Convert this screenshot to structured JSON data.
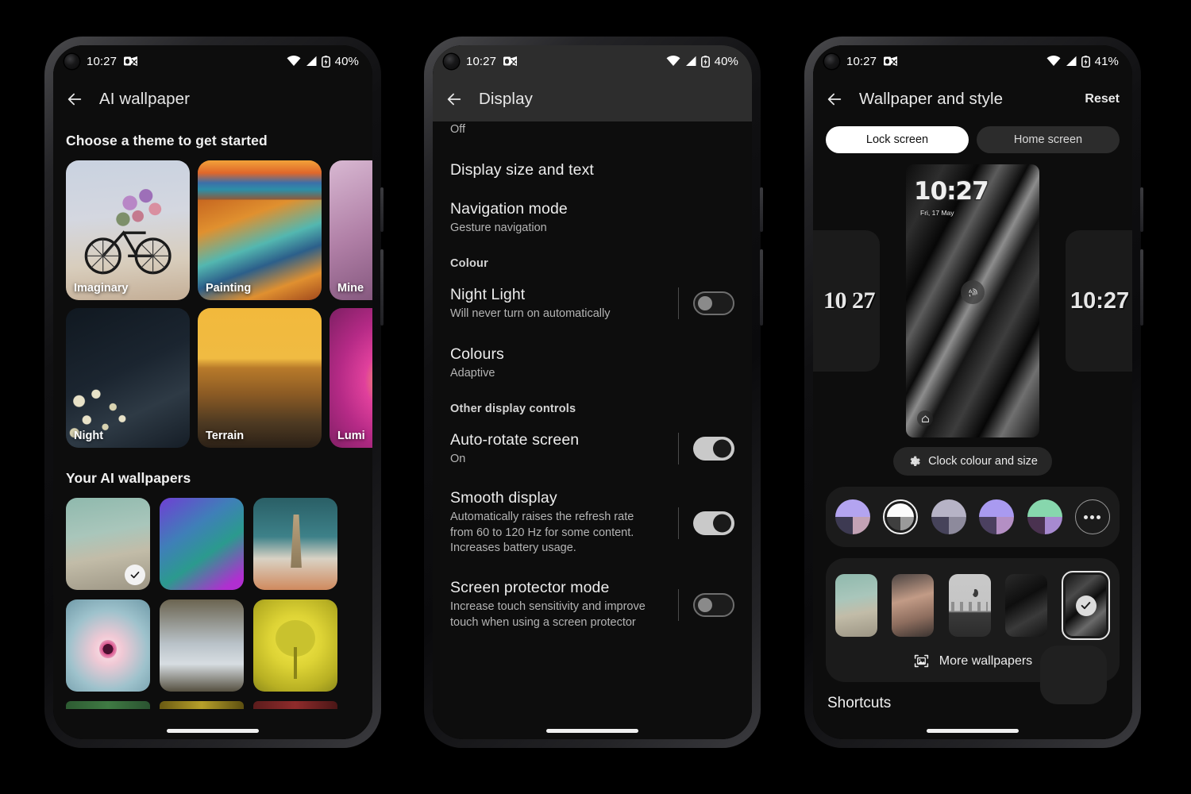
{
  "status_bar": {
    "time": "10:27",
    "battery_40": "40%",
    "battery_41": "41%",
    "icons": [
      "camera-punch-hole",
      "outlook-notification-icon",
      "wifi-icon",
      "cellular-signal-icon",
      "battery-icon"
    ]
  },
  "phone1": {
    "appbar": {
      "title": "AI wallpaper",
      "back_icon": "back-arrow-icon"
    },
    "section_title": "Choose a theme to get started",
    "themes": [
      {
        "label": "Imaginary",
        "art": "art-imaginary"
      },
      {
        "label": "Painting",
        "art": "art-painting"
      },
      {
        "label": "Mine",
        "art": "art-mine"
      },
      {
        "label": "Night",
        "art": "art-night"
      },
      {
        "label": "Terrain",
        "art": "art-terrain"
      },
      {
        "label": "Lumi",
        "art": "art-lumi"
      }
    ],
    "wallpapers_title": "Your AI wallpapers",
    "wallpapers": [
      {
        "art": "art-bridge",
        "selected": true
      },
      {
        "art": "art-crystal",
        "selected": false
      },
      {
        "art": "art-light",
        "selected": false
      },
      {
        "art": "art-flower",
        "selected": false
      },
      {
        "art": "art-threads",
        "selected": false
      },
      {
        "art": "art-tree",
        "selected": false
      }
    ]
  },
  "phone2": {
    "appbar": {
      "title": "Display",
      "back_icon": "back-arrow-icon"
    },
    "cut_off_value": "Off",
    "rows": [
      {
        "title": "Display size and text",
        "sub": "",
        "toggle": null
      },
      {
        "title": "Navigation mode",
        "sub": "Gesture navigation",
        "toggle": null
      }
    ],
    "category_colour": "Colour",
    "colour_rows": [
      {
        "title": "Night Light",
        "sub": "Will never turn on automatically",
        "toggle": "off"
      },
      {
        "title": "Colours",
        "sub": "Adaptive",
        "toggle": null
      }
    ],
    "category_other": "Other display controls",
    "other_rows": [
      {
        "title": "Auto-rotate screen",
        "sub": "On",
        "toggle": "on"
      },
      {
        "title": "Smooth display",
        "sub": "Automatically raises the refresh rate from 60 to 120 Hz for some content. Increases battery usage.",
        "toggle": "on"
      },
      {
        "title": "Screen protector mode",
        "sub": "Increase touch sensitivity and improve touch when using a screen protector",
        "toggle": "off"
      }
    ]
  },
  "phone3": {
    "appbar": {
      "title": "Wallpaper and style",
      "back_icon": "back-arrow-icon",
      "action": "Reset"
    },
    "tabs": [
      {
        "label": "Lock screen",
        "active": true
      },
      {
        "label": "Home screen",
        "active": false
      }
    ],
    "preview": {
      "left_clock": "10 27",
      "right_clock": "10:27",
      "lock_clock": "10:27",
      "lock_date": "Fri, 17 May",
      "fingerprint_icon": "fingerprint-icon",
      "home_icon": "home-icon"
    },
    "clock_cta": {
      "label": "Clock colour and size",
      "icon": "gear-icon"
    },
    "swatches": [
      {
        "top": "#b3a4f0",
        "bl": "#3d3a52",
        "br": "#c3a2b5",
        "selected": false
      },
      {
        "top": "#fbfbfb",
        "bl": "#3f3f3f",
        "br": "#9a9a9a",
        "selected": true
      },
      {
        "top": "#b6b3c6",
        "bl": "#46435a",
        "br": "#8d8a9c",
        "selected": false
      },
      {
        "top": "#a99af0",
        "bl": "#4b4060",
        "br": "#b48fc4",
        "selected": false
      },
      {
        "top": "#87d7ad",
        "bl": "#4a3250",
        "br": "#a78ad0",
        "selected": false
      }
    ],
    "swatch_more_icon": "more-options-icon",
    "thumbnails": [
      {
        "art": "art-bridge",
        "selected": false
      },
      {
        "art": "art-portrait",
        "selected": false
      },
      {
        "art": "art-moon",
        "selected": false
      },
      {
        "art": "art-darkabs",
        "selected": false
      },
      {
        "art": "art-rock",
        "selected": true
      }
    ],
    "more_wallpapers": {
      "label": "More wallpapers",
      "icon": "image-picker-icon"
    },
    "shortcuts_title": "Shortcuts"
  }
}
